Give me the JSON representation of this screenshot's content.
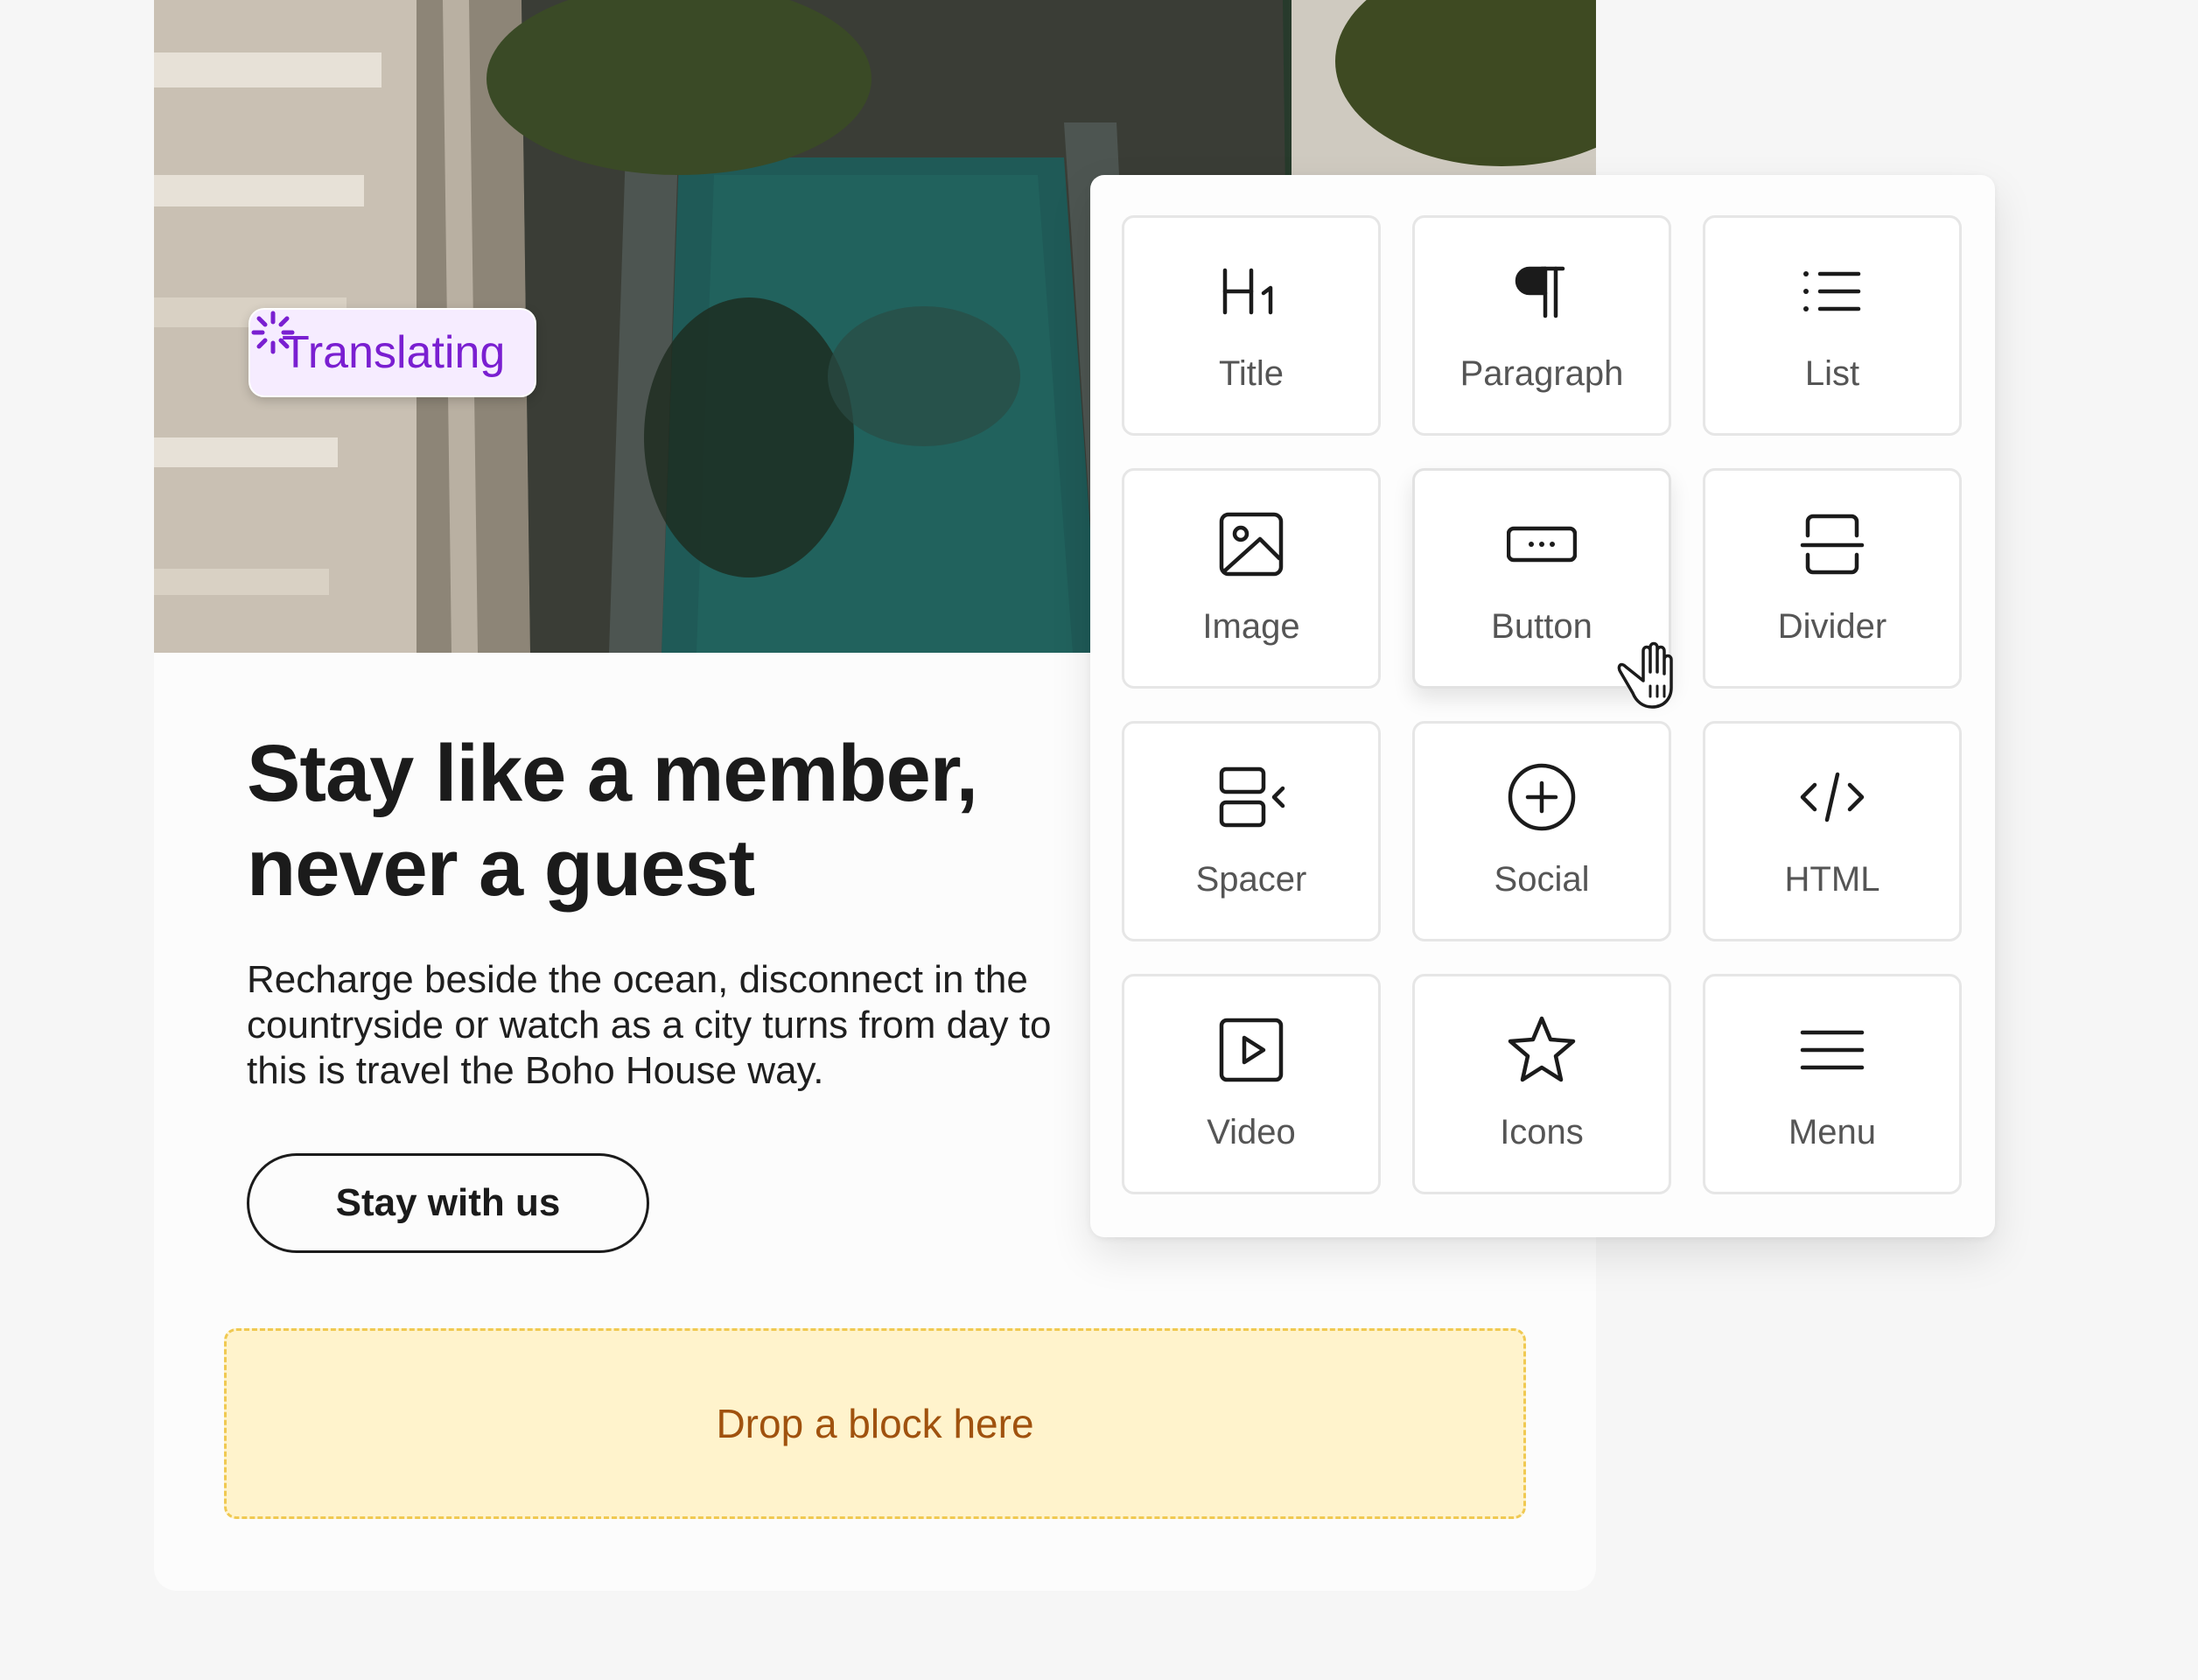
{
  "status_badge": {
    "label": "Translating",
    "icon": "spinner-icon",
    "color": "#7a1fd1"
  },
  "email": {
    "headline_line1": "Stay like a member,",
    "headline_line2": "never a guest",
    "body_line1": "Recharge beside the ocean, disconnect in the",
    "body_line2": "countryside or watch as a city turns from day to",
    "body_line3": "this is travel the Boho House way.",
    "cta_label": "Stay with us",
    "dropzone_label": "Drop a block here"
  },
  "blocks": [
    {
      "label": "Title",
      "icon": "heading-icon"
    },
    {
      "label": "Paragraph",
      "icon": "pilcrow-icon"
    },
    {
      "label": "List",
      "icon": "list-icon"
    },
    {
      "label": "Image",
      "icon": "image-icon"
    },
    {
      "label": "Button",
      "icon": "button-icon"
    },
    {
      "label": "Divider",
      "icon": "divider-icon"
    },
    {
      "label": "Spacer",
      "icon": "spacer-icon"
    },
    {
      "label": "Social",
      "icon": "plus-circle-icon"
    },
    {
      "label": "HTML",
      "icon": "code-icon"
    },
    {
      "label": "Video",
      "icon": "video-icon"
    },
    {
      "label": "Icons",
      "icon": "star-icon"
    },
    {
      "label": "Menu",
      "icon": "menu-icon"
    }
  ],
  "colors": {
    "accent": "#7a1fd1",
    "dropzone_bg": "#fff3cc",
    "dropzone_border": "#f0c952",
    "dropzone_text": "#a0520e"
  }
}
